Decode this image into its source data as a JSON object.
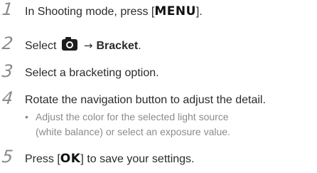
{
  "steps": [
    {
      "number": "1",
      "text_before": "In Shooting mode, press [",
      "key": "MENU",
      "text_after": "]."
    },
    {
      "number": "2",
      "text_before": "Select",
      "icon": "camera-icon",
      "arrow": "→",
      "bold": "Bracket",
      "text_after": "."
    },
    {
      "number": "3",
      "text": "Select a bracketing option."
    },
    {
      "number": "4",
      "text": "Rotate the navigation button to adjust the detail.",
      "bullet": "•",
      "subtext_line1": "Adjust the color for the selected light source",
      "subtext_line2": "(white balance) or select an exposure value."
    },
    {
      "number": "5",
      "text_before": "Press [",
      "key": "OK",
      "text_after": "] to save your settings."
    }
  ]
}
